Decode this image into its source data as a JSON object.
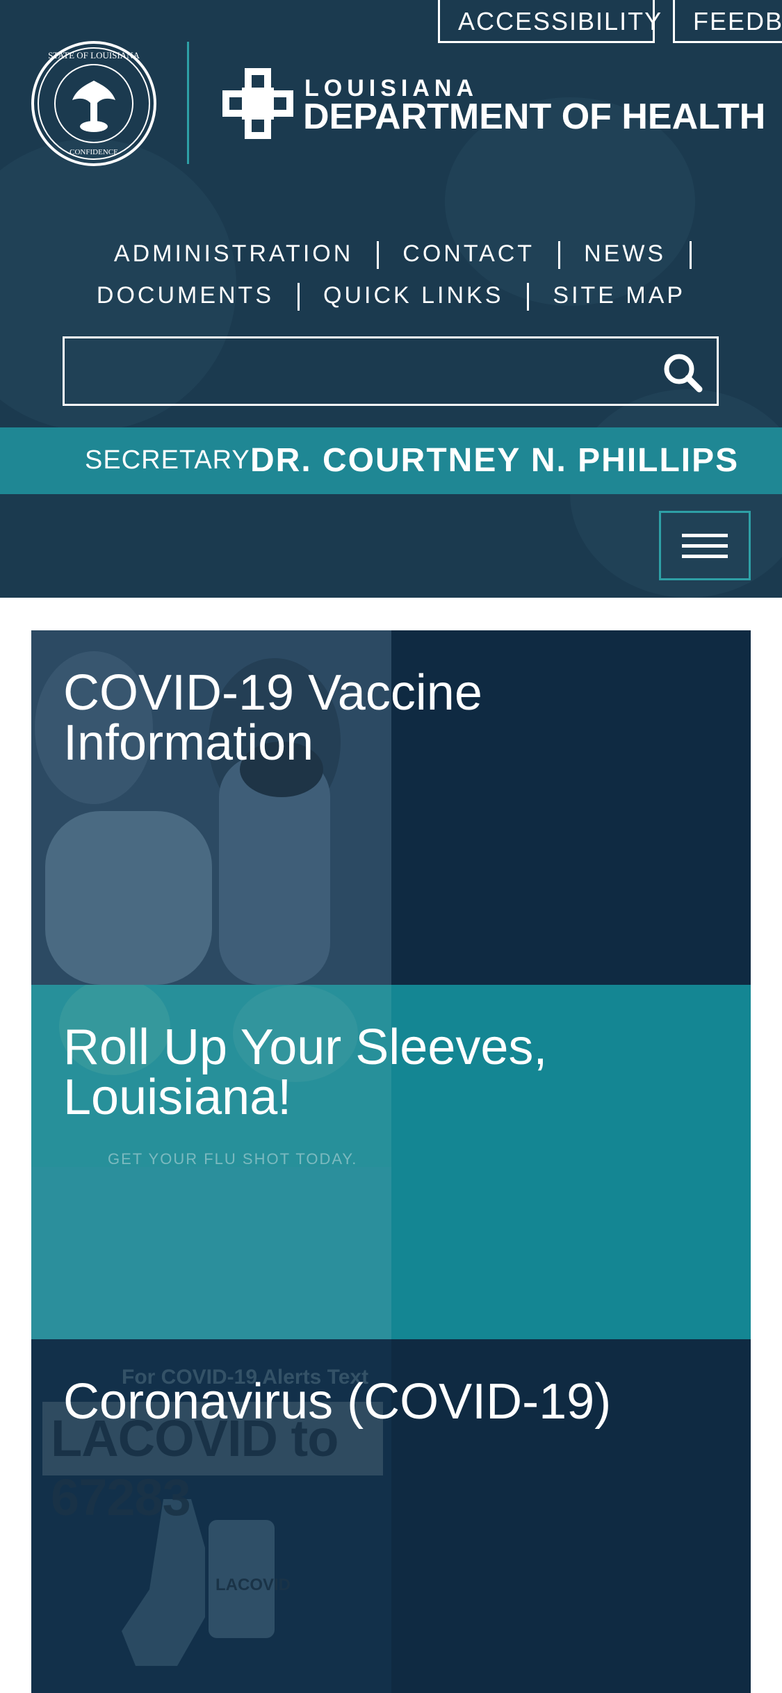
{
  "header": {
    "top_buttons": {
      "accessibility": "ACCESSIBILITY",
      "feedback": "FEEDBACK"
    },
    "logo": {
      "line1": "LOUISIANA",
      "line2": "DEPARTMENT OF HEALTH"
    },
    "seal_text": "STATE OF LOUISIANA · UNION JUSTICE CONFIDENCE",
    "nav": [
      {
        "label": "ADMINISTRATION"
      },
      {
        "label": "CONTACT"
      },
      {
        "label": "NEWS"
      },
      {
        "label": "DOCUMENTS"
      },
      {
        "label": "QUICK LINKS"
      },
      {
        "label": "SITE MAP"
      }
    ],
    "search": {
      "placeholder": "",
      "value": ""
    },
    "secretary": {
      "label": "SECRETARY",
      "name": "DR. COURTNEY N. PHILLIPS"
    }
  },
  "cards": [
    {
      "title": "COVID-19 Vaccine Information"
    },
    {
      "title": "Roll Up Your Sleeves, Louisiana!",
      "poster_caption": "GET YOUR FLU SHOT TODAY.",
      "poster_title": "Roll Up Your Sleeves, Louisiana!"
    },
    {
      "title": "Coronavirus (COVID-19)",
      "poster_caption": "For COVID-19 Alerts Text",
      "poster_title": "LACOVID to 67283",
      "poster_phone_label": "LACOVID"
    }
  ],
  "icons": {
    "search": "search-icon",
    "menu": "hamburger-menu-icon",
    "cross": "health-cross-icon",
    "seal": "state-seal-icon"
  },
  "colors": {
    "header_bg": "#1b3a4f",
    "teal": "#1f8794",
    "navy": "#0f2a42"
  }
}
